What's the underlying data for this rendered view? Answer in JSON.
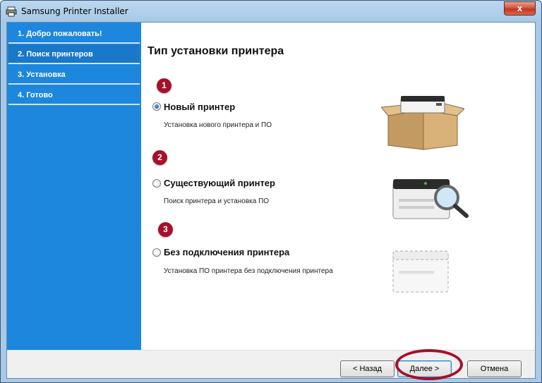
{
  "window": {
    "title": "Samsung Printer Installer",
    "close_glyph": "x"
  },
  "sidebar": {
    "steps": [
      {
        "label": "1. Добро пожаловать!"
      },
      {
        "label": "2. Поиск принтеров"
      },
      {
        "label": "3. Установка"
      },
      {
        "label": "4. Готово"
      }
    ],
    "active_step": 1
  },
  "content": {
    "heading": "Тип установки принтера",
    "options": [
      {
        "number": "1",
        "label": "Новый принтер",
        "description": "Установка нового принтера и ПО",
        "selected": true,
        "icon": "printer-in-box-icon"
      },
      {
        "number": "2",
        "label": "Существующий принтер",
        "description": "Поиск принтера и установка ПО",
        "selected": false,
        "icon": "printer-search-icon"
      },
      {
        "number": "3",
        "label": "Без подключения принтера",
        "description": "Установка ПО принтера без подключения принтера",
        "selected": false,
        "icon": "printer-offline-icon"
      }
    ]
  },
  "footer": {
    "back_label": "< Назад",
    "next_label": "Далее >",
    "cancel_label": "Отмена"
  },
  "colors": {
    "sidebar": "#1d87dd",
    "badge": "#a5112a",
    "highlight_ring": "#a5112a"
  }
}
